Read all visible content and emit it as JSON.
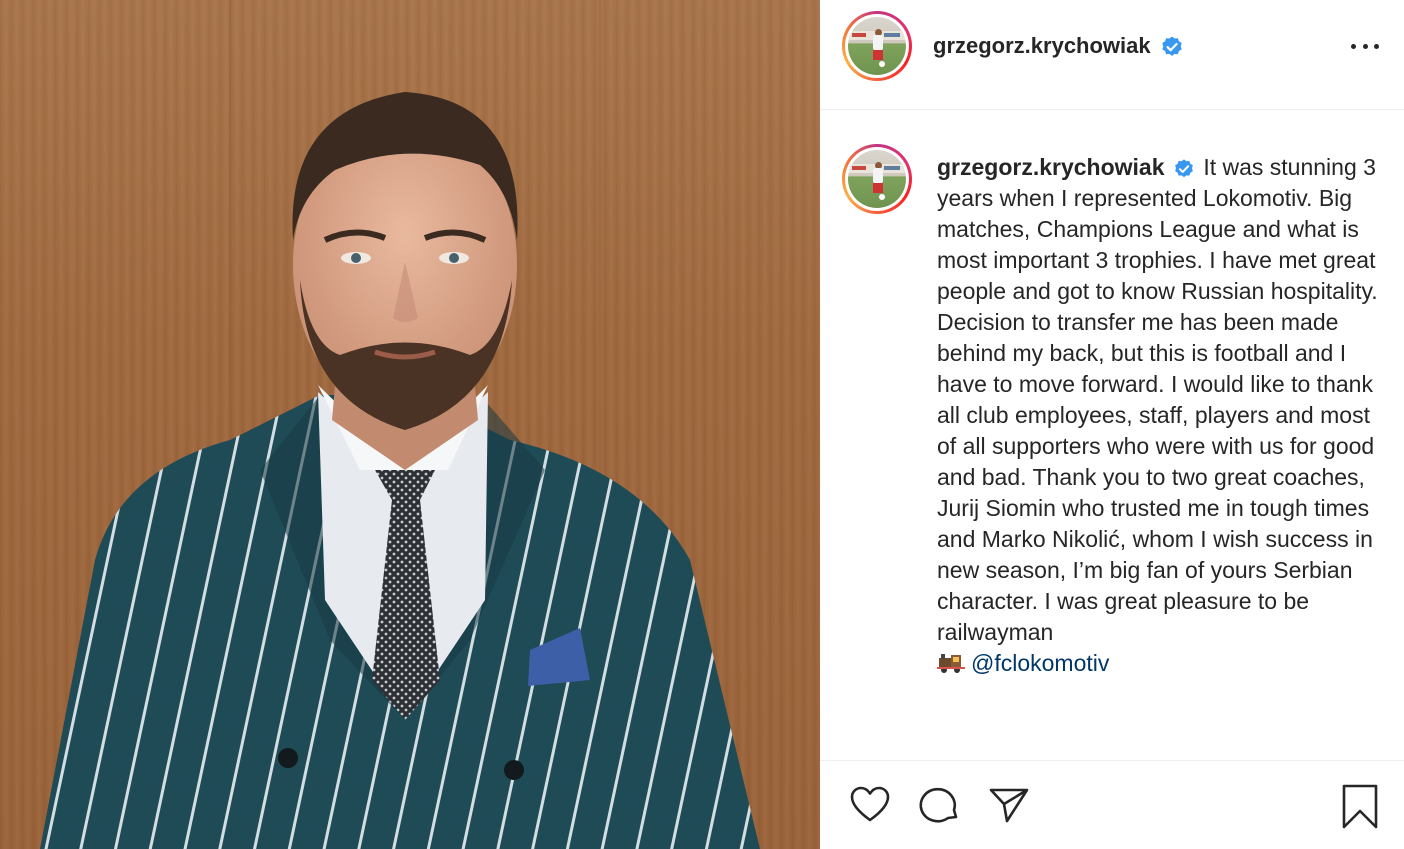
{
  "post": {
    "username": "grzegorz.krychowiak",
    "caption_text": "It was stunning 3 years when I represented Lokomotiv. Big matches, Champions League and what is most important 3 trophies. I have met great people and got to know Russian hospitality. Decision to transfer me has been made behind my back, but this is football and I have to move forward. I would like to thank all club employees, staff, players and most of all supporters who were with us for good and bad. Thank you to two great coaches, Jurij Siomin who trusted me in tough times and Marko Nikolić, whom I wish success in new season, I’m big fan of yours Serbian character. I was great pleasure to be railwayman",
    "mention": "@fclokomotiv",
    "emoji": "train-emoji"
  },
  "icons": {
    "verified": "verified-badge-icon",
    "more": "more-options-icon",
    "like": "heart-icon",
    "comment": "comment-icon",
    "share": "paper-plane-icon",
    "save": "bookmark-icon"
  },
  "colors": {
    "verified_blue": "#3897f0",
    "text": "#262626",
    "mention": "#00376b",
    "divider": "#efefef"
  }
}
